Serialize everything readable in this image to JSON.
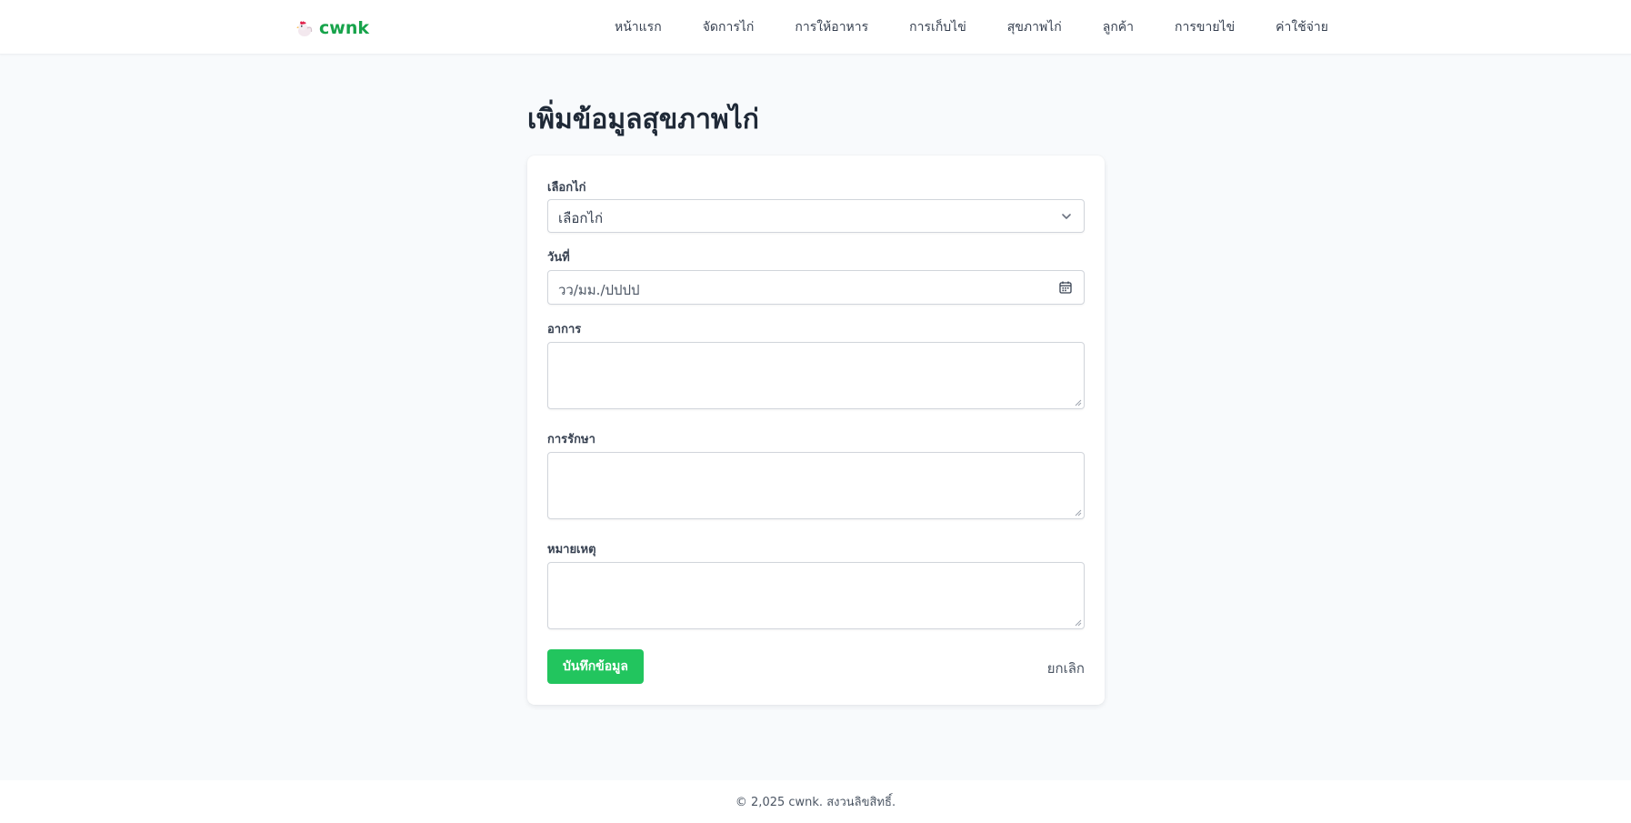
{
  "brand": {
    "name": "cwnk",
    "logo_icon": "chicken-icon",
    "color": "#16a34a"
  },
  "nav": {
    "items": [
      {
        "label": "หน้าแรก"
      },
      {
        "label": "จัดการไก่"
      },
      {
        "label": "การให้อาหาร"
      },
      {
        "label": "การเก็บไข่"
      },
      {
        "label": "สุขภาพไก่"
      },
      {
        "label": "ลูกค้า"
      },
      {
        "label": "การขายไข่"
      },
      {
        "label": "ค่าใช้จ่าย"
      }
    ]
  },
  "page": {
    "title": "เพิ่มข้อมูลสุขภาพไก่"
  },
  "form": {
    "chicken": {
      "label": "เลือกไก่",
      "value": "เลือกไก่",
      "icon": "chevron-down-icon"
    },
    "date": {
      "label": "วันที่",
      "placeholder": "วว/มม./ปปปป",
      "icon": "calendar-icon"
    },
    "symptoms": {
      "label": "อาการ",
      "value": ""
    },
    "treatment": {
      "label": "การรักษา",
      "value": ""
    },
    "note": {
      "label": "หมายเหตุ",
      "value": ""
    },
    "save_label": "บันทึกข้อมูล",
    "cancel_label": "ยกเลิก"
  },
  "footer": {
    "text": "© 2,025 cwnk. สงวนลิขสิทธิ์."
  },
  "colors": {
    "accent": "#22c55e",
    "background": "#f8fafc",
    "text": "#1f2937"
  }
}
